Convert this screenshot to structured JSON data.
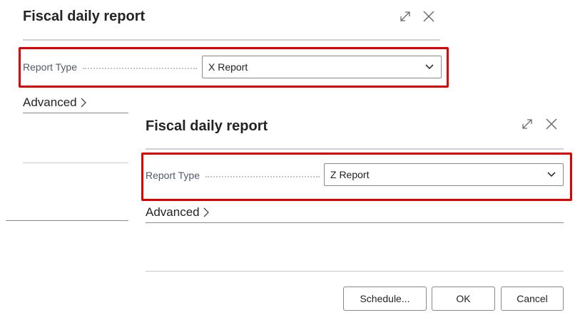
{
  "back_dialog": {
    "title": "Fiscal daily report",
    "report_type_label": "Report Type",
    "report_type_value": "X Report",
    "advanced_label": "Advanced"
  },
  "front_dialog": {
    "title": "Fiscal daily report",
    "report_type_label": "Report Type",
    "report_type_value": "Z Report",
    "advanced_label": "Advanced",
    "buttons": {
      "schedule": "Schedule...",
      "ok": "OK",
      "cancel": "Cancel"
    }
  },
  "icons": [
    "expand-icon",
    "close-icon",
    "chevron-down-icon",
    "chevron-right-icon"
  ],
  "colors": {
    "highlight": "#e00000",
    "label": "#505a6b",
    "title": "#242424"
  }
}
